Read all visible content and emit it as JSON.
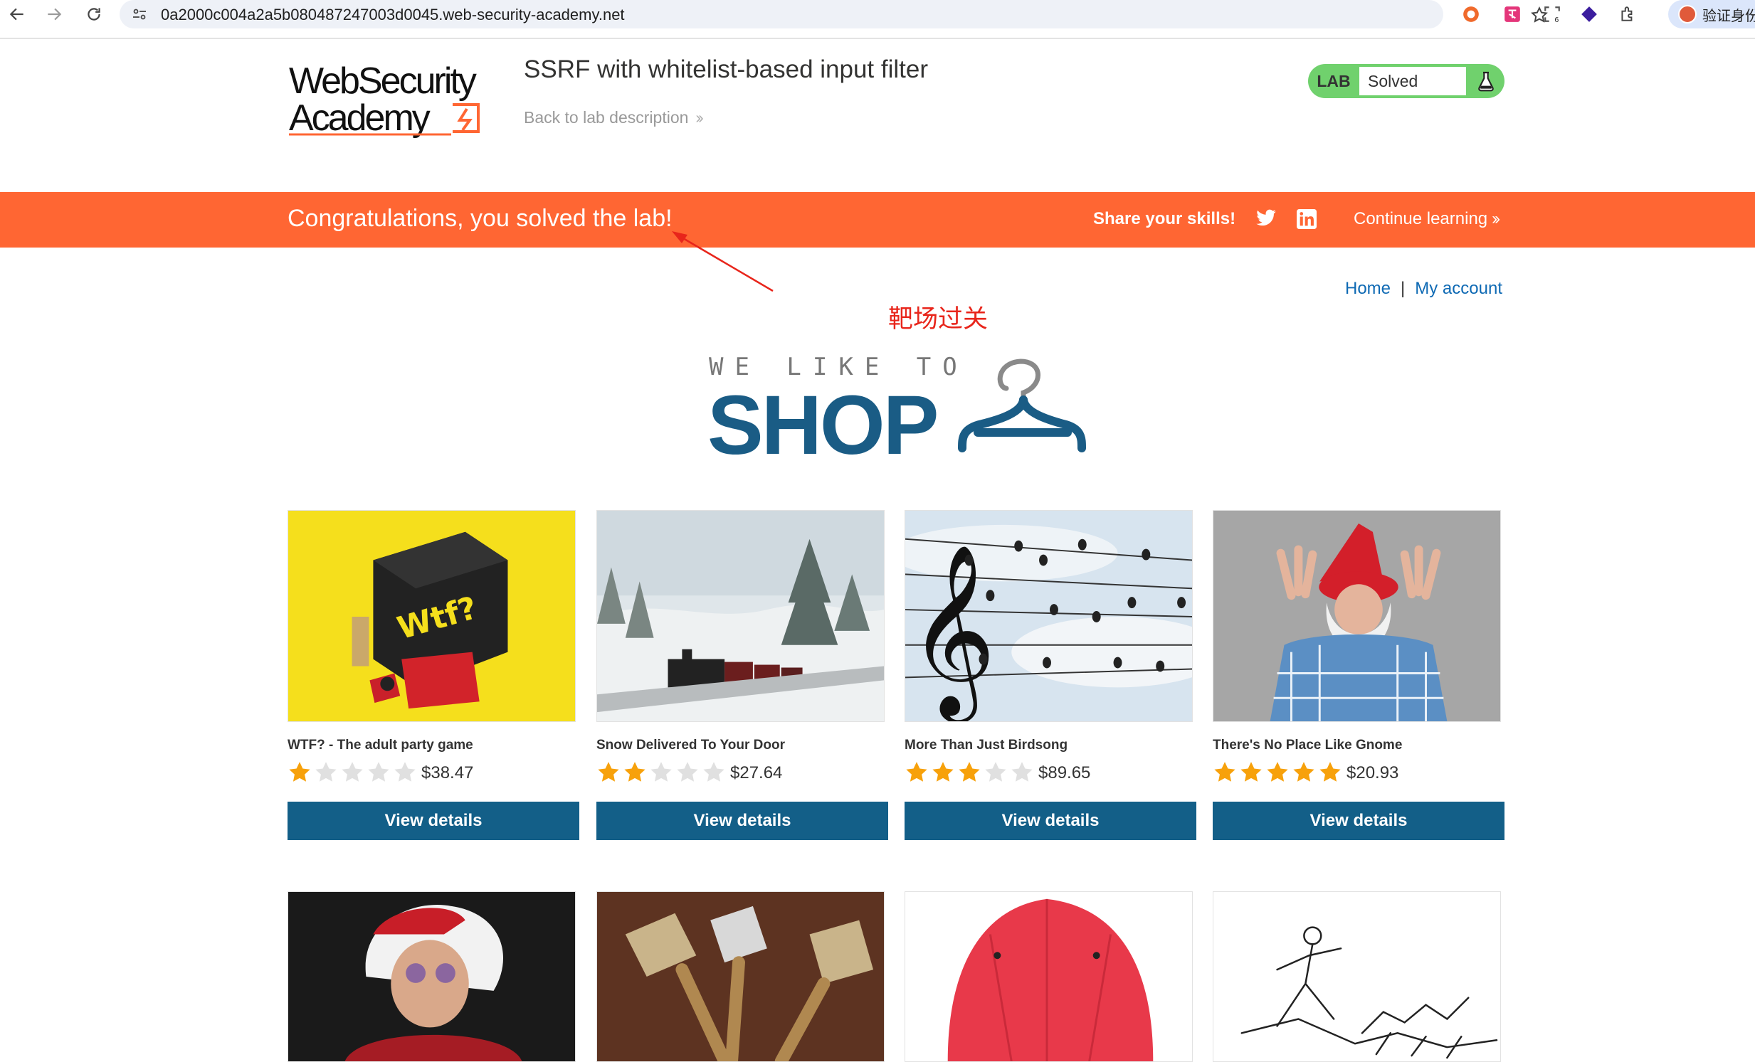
{
  "browser": {
    "url": "0a2000c004a2a5b080487247003d0045.web-security-academy.net",
    "profile_label": "验证身份"
  },
  "lab": {
    "title": "SSRF with whitelist-based input filter",
    "back_link": "Back to lab description",
    "status_tag": "LAB",
    "status_value": "Solved",
    "logo_line1": "WebSecurity",
    "logo_line2": "Academy"
  },
  "banner": {
    "message": "Congratulations, you solved the lab!",
    "share_label": "Share your skills!",
    "continue_label": "Continue learning"
  },
  "annotation": {
    "text": "靶场过关",
    "color": "#e8251b"
  },
  "shop_nav": {
    "home": "Home",
    "separator": "|",
    "my_account": "My account"
  },
  "shop_logo": {
    "tagline": "WE LIKE TO",
    "word": "SHOP"
  },
  "products": [
    {
      "name": "WTF? - The adult party game",
      "rating": 1,
      "price": "$38.47",
      "button": "View details"
    },
    {
      "name": "Snow Delivered To Your Door",
      "rating": 2,
      "price": "$27.64",
      "button": "View details"
    },
    {
      "name": "More Than Just Birdsong",
      "rating": 3,
      "price": "$89.65",
      "button": "View details"
    },
    {
      "name": "There's No Place Like Gnome",
      "rating": 5,
      "price": "$20.93",
      "button": "View details"
    }
  ],
  "colors": {
    "banner": "#ff6633",
    "primary_button": "#135f88",
    "link": "#0f6ab4",
    "star_filled": "#f7a10b",
    "star_empty": "#e0e0e0",
    "lab_solved": "#70d16d"
  }
}
